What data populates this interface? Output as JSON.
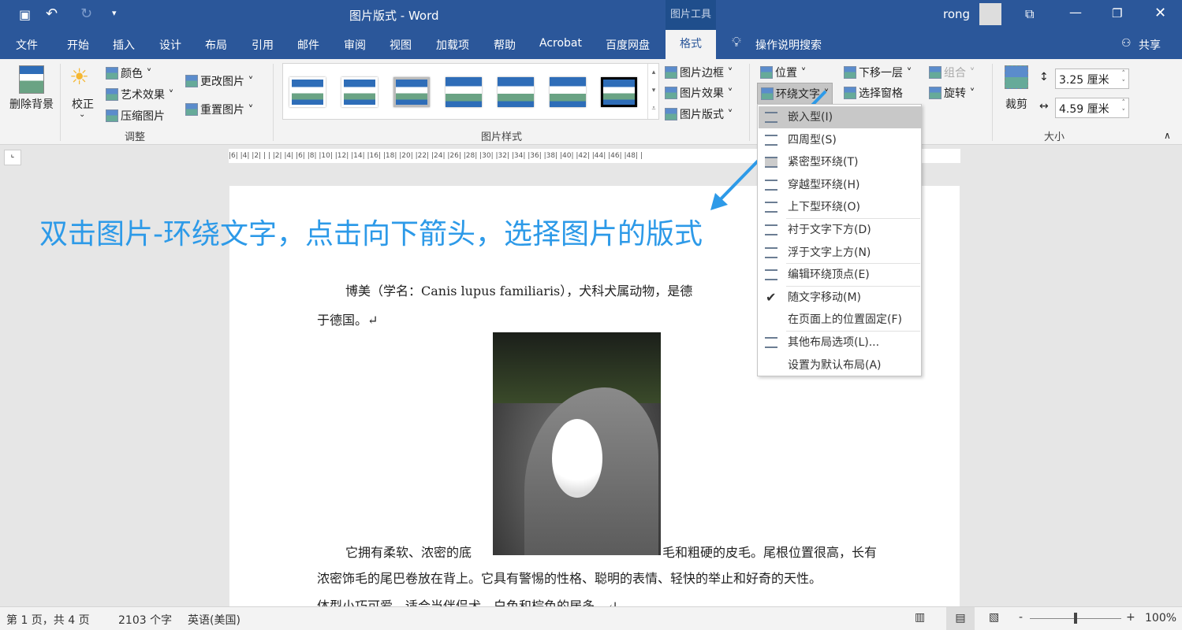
{
  "window": {
    "title": "图片版式 - Word",
    "context_tab": "图片工具",
    "user": "rong",
    "share": "共享",
    "search": "操作说明搜索"
  },
  "tabs": [
    "文件",
    "开始",
    "插入",
    "设计",
    "布局",
    "引用",
    "邮件",
    "审阅",
    "视图",
    "加载项",
    "帮助",
    "Acrobat",
    "百度网盘",
    "格式"
  ],
  "ribbon": {
    "adjust": {
      "remove_bg": "删除背景",
      "correct": "校正",
      "color": "颜色",
      "art": "艺术效果",
      "compress": "压缩图片",
      "change": "更改图片",
      "reset": "重置图片",
      "group": "调整"
    },
    "styles": {
      "border": "图片边框",
      "effect": "图片效果",
      "layout": "图片版式",
      "group": "图片样式"
    },
    "arrange": {
      "position": "位置",
      "wrap": "环绕文字",
      "back": "下移一层",
      "pane": "选择窗格",
      "group_btn": "组合",
      "rotate": "旋转"
    },
    "size": {
      "crop": "裁剪",
      "height": "3.25 厘米",
      "width": "4.59 厘米",
      "group": "大小"
    }
  },
  "ruler": "|6| |4| |2| | | |2| |4| |6| |8| |10| |12| |14| |16| |18| |20| |22| |24| |26| |28| |30| |32| |34| |36| |38| |40| |42| |44| |46| |48| |",
  "annotation": "双击图片-环绕文字，点击向下箭头，选择图片的版式",
  "document": {
    "p1_line1": "博美（学名：Canis lupus familiaris），犬科犬属动物，是德",
    "p1_line2": "于德国。↵",
    "p2_left": "它拥有柔软、浓密的底",
    "p2_right": "毛和粗硬的皮毛。尾根位置很高，长有",
    "p2_line2": "浓密饰毛的尾巴卷放在背上。它具有警惕的性格、聪明的表情、轻快的举止和好奇的天性。",
    "p2_line3": "体型小巧可爱，适合当伴侣犬，白色和棕色的居多。↵"
  },
  "wrap_menu": [
    {
      "label": "嵌入型(I)",
      "highlighted": true
    },
    {
      "label": "四周型(S)"
    },
    {
      "label": "紧密型环绕(T)"
    },
    {
      "label": "穿越型环绕(H)"
    },
    {
      "label": "上下型环绕(O)"
    },
    {
      "label": "衬于文字下方(D)"
    },
    {
      "label": "浮于文字上方(N)"
    },
    {
      "label": "编辑环绕顶点(E)"
    },
    {
      "label": "随文字移动(M)",
      "checked": true
    },
    {
      "label": "在页面上的位置固定(F)"
    },
    {
      "label": "其他布局选项(L)..."
    },
    {
      "label": "设置为默认布局(A)"
    }
  ],
  "status": {
    "page": "第 1 页，共 4 页",
    "words": "2103 个字",
    "lang": "英语(美国)",
    "zoom": "100%",
    "zoom_percent": 100
  },
  "colors": {
    "brand": "#2b579a",
    "annotation": "#2d9ae8"
  }
}
